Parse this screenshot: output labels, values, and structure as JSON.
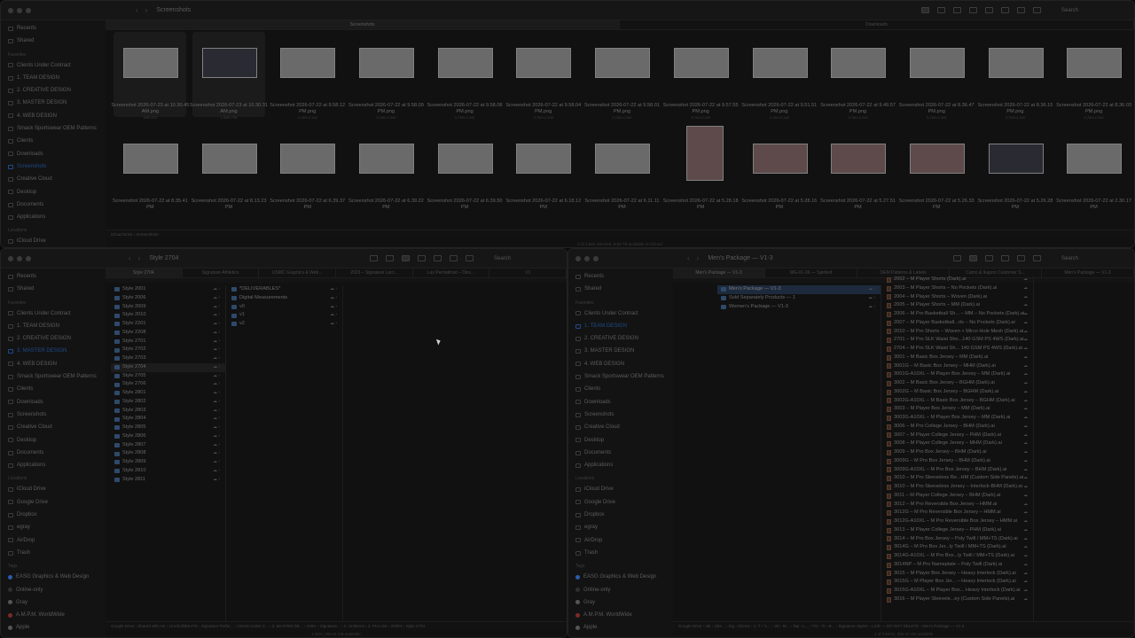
{
  "top": {
    "title": "Screenshots",
    "search": "Search",
    "tabs": [
      "Screenshots",
      "Downloads"
    ],
    "sidebar": [
      {
        "label": "Recents"
      },
      {
        "label": "Shared"
      },
      {
        "head": "Favorites"
      },
      {
        "label": "Clients Under Contract"
      },
      {
        "label": "1. TEAM DESIGN"
      },
      {
        "label": "2. CREATIVE DESIGN"
      },
      {
        "label": "3. MASTER DESIGN"
      },
      {
        "label": "4. WEB DESIGN"
      },
      {
        "label": "Smack Sportswear OEM Patterns"
      },
      {
        "label": "Clients"
      },
      {
        "label": "Downloads"
      },
      {
        "label": "Screenshots",
        "sel": true
      },
      {
        "label": "Creative Cloud"
      },
      {
        "label": "Desktop"
      },
      {
        "label": "Documents"
      },
      {
        "label": "Applications"
      },
      {
        "head": "Locations"
      },
      {
        "label": "iCloud Drive"
      }
    ],
    "row1": [
      {
        "name": "Screenshot 2026-07-23 at 10.30.45 AM.png",
        "dim": "940×222",
        "kind": "light",
        "sel": true
      },
      {
        "name": "Screenshot 2026-07-23 at 10.30.31 AM.png",
        "dim": "1,538×708",
        "kind": "dark",
        "sel": true
      },
      {
        "name": "Screenshot 2026-07-22 at 9.58.12 PM.png",
        "dim": "3,760×2,340",
        "kind": "light"
      },
      {
        "name": "Screenshot 2026-07-22 at 9.58.09 PM.png",
        "dim": "3,760×2,340",
        "kind": "light"
      },
      {
        "name": "Screenshot 2026-07-22 at 9.58.08 PM.png",
        "dim": "3,760×2,340",
        "kind": "light"
      },
      {
        "name": "Screenshot 2026-07-22 at 9.58.04 PM.png",
        "dim": "3,760×2,340",
        "kind": "light"
      },
      {
        "name": "Screenshot 2026-07-22 at 9.58.01 PM.png",
        "dim": "3,760×2,340",
        "kind": "light"
      },
      {
        "name": "Screenshot 2026-07-22 at 9.57.55 PM.png",
        "dim": "3,760×2,340",
        "kind": "light"
      },
      {
        "name": "Screenshot 2026-07-22 at 9.51.51 PM.png",
        "dim": "3,760×2,340",
        "kind": "light"
      },
      {
        "name": "Screenshot 2026-07-22 at 9.49.57 PM.png",
        "dim": "3,760×2,340",
        "kind": "light"
      },
      {
        "name": "Screenshot 2026-07-22 at 8.36.47 PM.png",
        "dim": "3,760×2,340",
        "kind": "light"
      },
      {
        "name": "Screenshot 2026-07-22 at 8.36.15 PM.png",
        "dim": "3,760×2,340",
        "kind": "light"
      },
      {
        "name": "Screenshot 2026-07-22 at 8.36.03 PM.png",
        "dim": "3,760×2,340",
        "kind": "light"
      }
    ],
    "row2": [
      {
        "name": "Screenshot 2026-07-22 at 8.35.41 PM",
        "kind": "light"
      },
      {
        "name": "Screenshot 2026-07-22 at 8.13.23 PM",
        "kind": "light"
      },
      {
        "name": "Screenshot 2026-07-22 at 6.39.37 PM",
        "kind": "light"
      },
      {
        "name": "Screenshot 2026-07-22 at 6.39.22 PM",
        "kind": "light"
      },
      {
        "name": "Screenshot 2026-07-22 at 6.39.50 PM",
        "kind": "light"
      },
      {
        "name": "Screenshot 2026-07-22 at 6.18.12 PM",
        "kind": "light"
      },
      {
        "name": "Screenshot 2026-07-22 at 6.11.11 PM",
        "kind": "light"
      },
      {
        "name": "Screenshot 2026-07-22 at 5.28.18 PM",
        "kind": "tall"
      },
      {
        "name": "Screenshot 2026-07-22 at 5.28.16 PM",
        "kind": "red"
      },
      {
        "name": "Screenshot 2026-07-22 at 5.27.51 PM",
        "kind": "red"
      },
      {
        "name": "Screenshot 2026-07-22 at 5.26.33 PM",
        "kind": "red"
      },
      {
        "name": "Screenshot 2026-07-22 at 5.26.28 PM",
        "kind": "dark"
      },
      {
        "name": "Screenshot 2026-07-22 at 2.30.17 PM",
        "kind": "light"
      }
    ],
    "path": [
      "iCloud Drive",
      "Screenshots"
    ],
    "status": "2 of 1,582 selected, 8.52 TB available on iCloud"
  },
  "left": {
    "title": "Style 2704",
    "search": "Search",
    "tabs": [
      "Style 2704",
      "Signature Athletics",
      "USMC Graphics & Web...",
      "2023 – Signature Lacr...",
      "Lax Permafrost – Diss...",
      "V1"
    ],
    "sidebar": [
      {
        "label": "Recents"
      },
      {
        "label": "Shared"
      },
      {
        "head": "Favorites"
      },
      {
        "label": "Clients Under Contract"
      },
      {
        "label": "1. TEAM DESIGN"
      },
      {
        "label": "2. CREATIVE DESIGN"
      },
      {
        "label": "3. MASTER DESIGN",
        "sel": true
      },
      {
        "label": "4. WEB DESIGN"
      },
      {
        "label": "Smack Sportswear OEM Patterns"
      },
      {
        "label": "Clients"
      },
      {
        "label": "Downloads"
      },
      {
        "label": "Screenshots"
      },
      {
        "label": "Creative Cloud"
      },
      {
        "label": "Desktop"
      },
      {
        "label": "Documents"
      },
      {
        "label": "Applications"
      },
      {
        "head": "Locations"
      },
      {
        "label": "iCloud Drive"
      },
      {
        "label": "Google Drive"
      },
      {
        "label": "Dropbox"
      },
      {
        "label": "egray"
      },
      {
        "label": "AirDrop"
      },
      {
        "label": "Trash"
      },
      {
        "head": "Tags"
      },
      {
        "label": "EASG Graphics & Web Design",
        "tag": "#2a5caa"
      },
      {
        "label": "Online-only",
        "tag": "#2f2f2f"
      },
      {
        "label": "Gray",
        "tag": "#555555"
      },
      {
        "label": "A.M.P.M. WorldWide",
        "tag": "#7a2a2a"
      },
      {
        "label": "Apple",
        "tag": "#555555"
      }
    ],
    "col1": [
      "Style 2001",
      "Style 2006",
      "Style 2009",
      "Style 2010",
      "Style 2201",
      "Style 2208",
      "Style 2701",
      "Style 2702",
      "Style 2703",
      "Style 2704",
      "Style 2705",
      "Style 2706",
      "Style 2801",
      "Style 2802",
      "Style 2803",
      "Style 2804",
      "Style 2805",
      "Style 2806",
      "Style 2807",
      "Style 2808",
      "Style 2809",
      "Style 2810",
      "Style 2811"
    ],
    "col1_sel": 9,
    "col2": [
      "*DELIVERABLES*",
      "Digital Measurements",
      "v0",
      "v1",
      "v2"
    ],
    "path": [
      "Google Drive",
      "Shared with me",
      "1mAfcdNhKATE",
      "Signature Perfor...",
      "Clients Under C...",
      "3. MASTER DE...",
      "1004 – Signature...",
      "2. Uniforms",
      "3. Pro Line",
      "2000's",
      "Style 2704"
    ],
    "status": "1 item, 255.41 GB available"
  },
  "right": {
    "title": "Men's Package — V1-3",
    "search": "Search",
    "tabs": [
      "Men's Package — V1-3",
      "MG-01-06 — Spirited",
      "OEM Patterns & Labels",
      "Camo & Ikapon Customer S...",
      "Men's Package — V1-3"
    ],
    "sidebar": [
      {
        "label": "Recents"
      },
      {
        "label": "Shared"
      },
      {
        "head": "Favorites"
      },
      {
        "label": "Clients Under Contract"
      },
      {
        "label": "1. TEAM DESIGN",
        "sel": true
      },
      {
        "label": "2. CREATIVE DESIGN"
      },
      {
        "label": "3. MASTER DESIGN"
      },
      {
        "label": "4. WEB DESIGN"
      },
      {
        "label": "Smack Sportswear OEM Patterns"
      },
      {
        "label": "Clients"
      },
      {
        "label": "Downloads"
      },
      {
        "label": "Screenshots"
      },
      {
        "label": "Creative Cloud"
      },
      {
        "label": "Desktop"
      },
      {
        "label": "Documents"
      },
      {
        "label": "Applications"
      },
      {
        "head": "Locations"
      },
      {
        "label": "iCloud Drive"
      },
      {
        "label": "Google Drive"
      },
      {
        "label": "Dropbox"
      },
      {
        "label": "egray"
      },
      {
        "label": "AirDrop"
      },
      {
        "label": "Trash"
      },
      {
        "head": "Tags"
      },
      {
        "label": "EASG Graphics & Web Design",
        "tag": "#2a5caa"
      },
      {
        "label": "Online-only",
        "tag": "#2f2f2f"
      },
      {
        "label": "Gray",
        "tag": "#555555"
      },
      {
        "label": "A.M.P.M. WorldWide",
        "tag": "#7a2a2a"
      },
      {
        "label": "Apple",
        "tag": "#555555"
      }
    ],
    "col1": [
      "Men's Package — V1-3",
      "Sold Separately Products — 1",
      "Women's Package — V1-3"
    ],
    "col1_sel": 0,
    "col2": [
      "2002 – M Player Shorts (Dark).ai",
      "2003 – M Player Shorts – No Pockets (Dark).ai",
      "2004 – M Player Shorts – Woven (Dark).ai",
      "2005 – M Player Shorts – MM (Dark).ai",
      "2006 – M Pro Basketball Sh... – MM – No Pockets (Dark).ai",
      "2007 – M Player Basketball...rts – No Pockets (Dark).ai",
      "2010 – M Pro Shorts – Woven + Mirco Hole Mesh (Dark).ai",
      "2701 – M Pro SLK Waist Sho...140 GSM PS 4WS (Dark).ai",
      "2704 – M Pro SLK Waist Sh... 140 GSM PS 4WS (Dark).ai",
      "3001 – M Basic Box Jersey – MM (Dark).ai",
      "3001G – M Basic Box Jersey – MHM (Dark).ai",
      "3001G-A10XL – M Player Box Jersey – MM (Dark).ai",
      "3002 – M Basic Box Jersey – BGHM (Dark).ai",
      "3002G – M Basic Box Jersey – BGHM (Dark).ai",
      "3002G-A10XL – M Basic Box Jersey – BGHM (Dark).ai",
      "3003 – M Player Box Jersey – MM (Dark).ai",
      "3003G-A10XL – M Player Box Jersey – MM (Dark).ai",
      "3006 – M Pro College Jersey – BHM (Dark).ai",
      "3007 – M Player College Jersey – PHM (Dark).ai",
      "3008 – M Player College Jersey – MHM (Dark).ai",
      "3009 – M Pro Box Jersey – BHM (Dark).ai",
      "3009G – M Pro Box Jersey – BHM (Dark).ai",
      "3009G-A10XL – M Pro Box Jersey – BHM (Dark).ai",
      "3010 – M Pro Sleeveless Re...HM (Custom Side Panels).ai",
      "3010 – M Pro Sleeveless Jersey – Interlock-BHM (Dark).ai",
      "3011 – M Player College Jersey – BHM (Dark).ai",
      "3012 – M Pro Reversible Box Jersey – HMM.ai",
      "3012G – M Pro Reversible Box Jersey – HMM.ai",
      "3012G-A10XL – M Pro Reversible Box Jersey – HMM.ai",
      "3013 – M Player College Jersey – PHM (Dark).ai",
      "3014 – M Pro Box Jersey – Poly Twill / MM+TS (Dark).ai",
      "3014G – M Pro Box Jer...ly Twill / MM+TS (Dark).ai",
      "3014G-A10XL – M Pro Box...ly Twill / MM+TS (Dark).ai",
      "3014NP – M Pro Nameplate – Poly Twill (Dark).ai",
      "3015 – M Player Box Jersey – Heavy Interlock (Dark).ai",
      "3015G – M Player Box Jer... – Heavy Interlock (Dark).ai",
      "3015G-A10XL – M Player Box... Heavy Interlock (Dark).ai",
      "3016 – M Player Sleevele...ey (Custom Side Panels).ai"
    ],
    "path": [
      "Google Drive",
      "ebr",
      "Sha...",
      "Sig",
      "Clients",
      "1. T",
      "*L...",
      "Wi",
      "M...",
      "Tap",
      "L...",
      "*01",
      "*II",
      "B...",
      "Signature Styles – LIVE — DO NOT DELETE",
      "Men's Package — V1-3"
    ],
    "status": "1 of 3 items, 255.41 GB available"
  }
}
